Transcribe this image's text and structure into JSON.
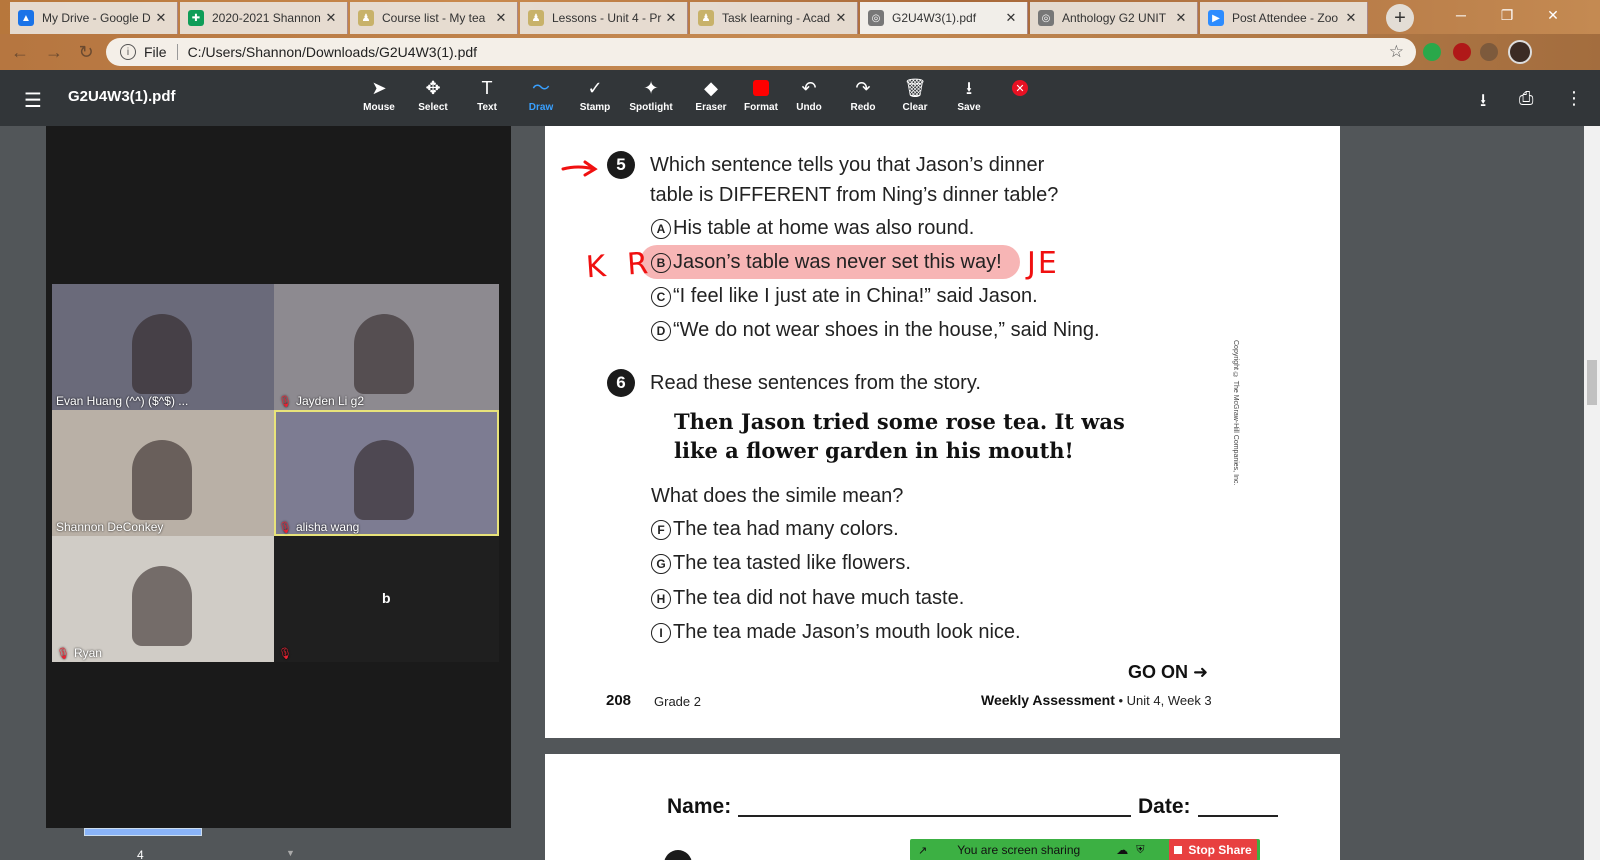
{
  "browser": {
    "tabs": [
      {
        "label": "My Drive - Google D",
        "color": "#1a73e8",
        "glyph": "▲"
      },
      {
        "label": "2020-2021 Shannon",
        "color": "#0f9d58",
        "glyph": "✚"
      },
      {
        "label": "Course list - My tea",
        "color": "#c8b26a",
        "glyph": "♟"
      },
      {
        "label": "Lessons - Unit 4 - Pr",
        "color": "#c8b26a",
        "glyph": "♟"
      },
      {
        "label": "Task learning - Acad",
        "color": "#c8b26a",
        "glyph": "♟"
      },
      {
        "label": "G2U4W3(1).pdf",
        "color": "#777777",
        "glyph": "◎"
      },
      {
        "label": "Anthology G2 UNIT",
        "color": "#777777",
        "glyph": "◎"
      },
      {
        "label": "Post Attendee - Zoo",
        "color": "#2d8cff",
        "glyph": "▶"
      }
    ],
    "new_tab": "+",
    "url_scheme": "File",
    "url": "C:/Users/Shannon/Downloads/G2U4W3(1).pdf"
  },
  "pdf_toolbar": {
    "title": "G2U4W3(1).pdf",
    "tools": [
      {
        "label": "Mouse",
        "icon": "➤"
      },
      {
        "label": "Select",
        "icon": "✥"
      },
      {
        "label": "Text",
        "icon": "T"
      },
      {
        "label": "Draw",
        "icon": "〜"
      },
      {
        "label": "Stamp",
        "icon": "✓"
      },
      {
        "label": "Spotlight",
        "icon": "✦"
      },
      {
        "label": "Eraser",
        "icon": "◆"
      },
      {
        "label": "Format",
        "icon": ""
      },
      {
        "label": "Undo",
        "icon": "↶"
      },
      {
        "label": "Redo",
        "icon": "↷"
      },
      {
        "label": "Clear",
        "icon": "🗑"
      },
      {
        "label": "Save",
        "icon": "⭳"
      }
    ],
    "selected_tool": "Draw"
  },
  "participants": [
    {
      "name": "Evan Huang (^^) ($^$) ...",
      "muted": false,
      "bg": "#6a6a7a"
    },
    {
      "name": "Jayden Li g2",
      "muted": true,
      "bg": "#8d8a90"
    },
    {
      "name": "Shannon DeConkey",
      "muted": false,
      "bg": "#b9b0a6"
    },
    {
      "name": "alisha wang",
      "muted": true,
      "bg": "#7d7c92"
    },
    {
      "name": "Ryan",
      "muted": true,
      "bg": "#d0ccc6"
    },
    {
      "name": "b",
      "muted": true,
      "bg": "#1f1f1f"
    }
  ],
  "worksheet": {
    "q5": {
      "number": "5",
      "line1": "Which sentence tells you that Jason’s dinner",
      "line2": "table is DIFFERENT from Ning’s dinner table?",
      "options": [
        {
          "letter": "A",
          "text": "His table at home was also round."
        },
        {
          "letter": "B",
          "text": "Jason’s table was never set this way!"
        },
        {
          "letter": "C",
          "text": "“I feel like I just ate in China!” said Jason."
        },
        {
          "letter": "D",
          "text": "“We do not wear shoes in the house,” said Ning."
        }
      ]
    },
    "annotations": {
      "left": "K R",
      "right": "JE"
    },
    "q6": {
      "number": "6",
      "prompt": "Read these sentences from the story.",
      "quote1": "Then Jason tried some rose tea. It was",
      "quote2": "like a flower garden in his mouth!",
      "question": "What does the simile mean?",
      "options": [
        {
          "letter": "F",
          "text": "The tea had many colors."
        },
        {
          "letter": "G",
          "text": "The tea tasted like flowers."
        },
        {
          "letter": "H",
          "text": "The tea did not have much taste."
        },
        {
          "letter": "I",
          "text": "The tea made Jason’s mouth look nice."
        }
      ]
    },
    "copyright": "Copyright © The McGraw-Hill Companies, Inc.",
    "go_on": "GO ON ➜",
    "page_number": "208",
    "grade": "Grade 2",
    "assessment_bold": "Weekly Assessment",
    "assessment_rest": " • Unit 4, Week 3",
    "page2_name": "Name:",
    "page2_date": "Date:"
  },
  "thumbnail_page": "4",
  "share": {
    "status": "You are screen sharing",
    "stop": "Stop Share"
  }
}
